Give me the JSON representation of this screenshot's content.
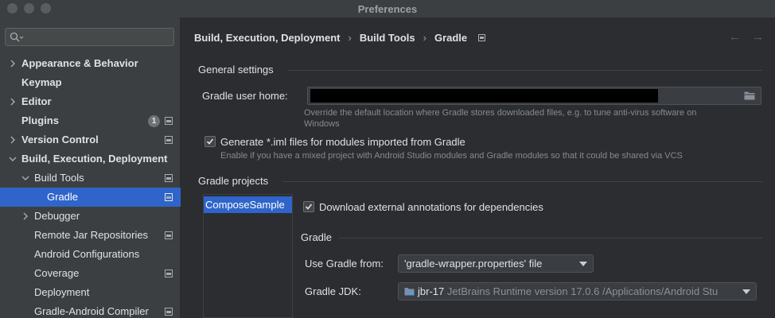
{
  "window": {
    "title": "Preferences"
  },
  "sidebar": {
    "items": [
      {
        "label": "Appearance & Behavior",
        "bold": true,
        "expandable": true
      },
      {
        "label": "Keymap",
        "bold": true
      },
      {
        "label": "Editor",
        "bold": true,
        "expandable": true
      },
      {
        "label": "Plugins",
        "bold": true,
        "badge": "1"
      },
      {
        "label": "Version Control",
        "bold": true,
        "expandable": true
      },
      {
        "label": "Build, Execution, Deployment",
        "bold": true,
        "expanded": true
      },
      {
        "label": "Build Tools",
        "expanded": true
      },
      {
        "label": "Gradle",
        "selected": true
      },
      {
        "label": "Debugger",
        "expandable": true
      },
      {
        "label": "Remote Jar Repositories"
      },
      {
        "label": "Android Configurations"
      },
      {
        "label": "Coverage"
      },
      {
        "label": "Deployment"
      },
      {
        "label": "Gradle-Android Compiler"
      }
    ]
  },
  "breadcrumb": {
    "items": [
      "Build, Execution, Deployment",
      "Build Tools",
      "Gradle"
    ],
    "separator": "›"
  },
  "nav": {
    "back": "←",
    "forward": "→"
  },
  "general": {
    "heading": "General settings",
    "user_home_label": "Gradle user home:",
    "user_home_hint_1": "Override the default location where Gradle stores downloaded files, e.g. to tune anti-virus software on",
    "user_home_hint_2": "Windows",
    "iml_label": "Generate *.iml files for modules imported from Gradle",
    "iml_checked": true,
    "iml_hint": "Enable if you have a mixed project with Android Studio modules and Gradle modules so that it could be shared via VCS"
  },
  "projects": {
    "heading": "Gradle projects",
    "list": [
      "ComposeSample"
    ],
    "annotations_label": "Download external annotations for dependencies",
    "annotations_checked": true,
    "gradle_heading": "Gradle",
    "use_from_label": "Use Gradle from:",
    "use_from_value": "'gradle-wrapper.properties' file",
    "jdk_label": "Gradle JDK:",
    "jdk_name": "jbr-17",
    "jdk_detail": "JetBrains Runtime version 17.0.6 /Applications/Android Stu"
  },
  "colors": {
    "selection": "#2f65ca",
    "sidebar_bg": "#3c3f41",
    "content_bg": "#2b2d30"
  }
}
